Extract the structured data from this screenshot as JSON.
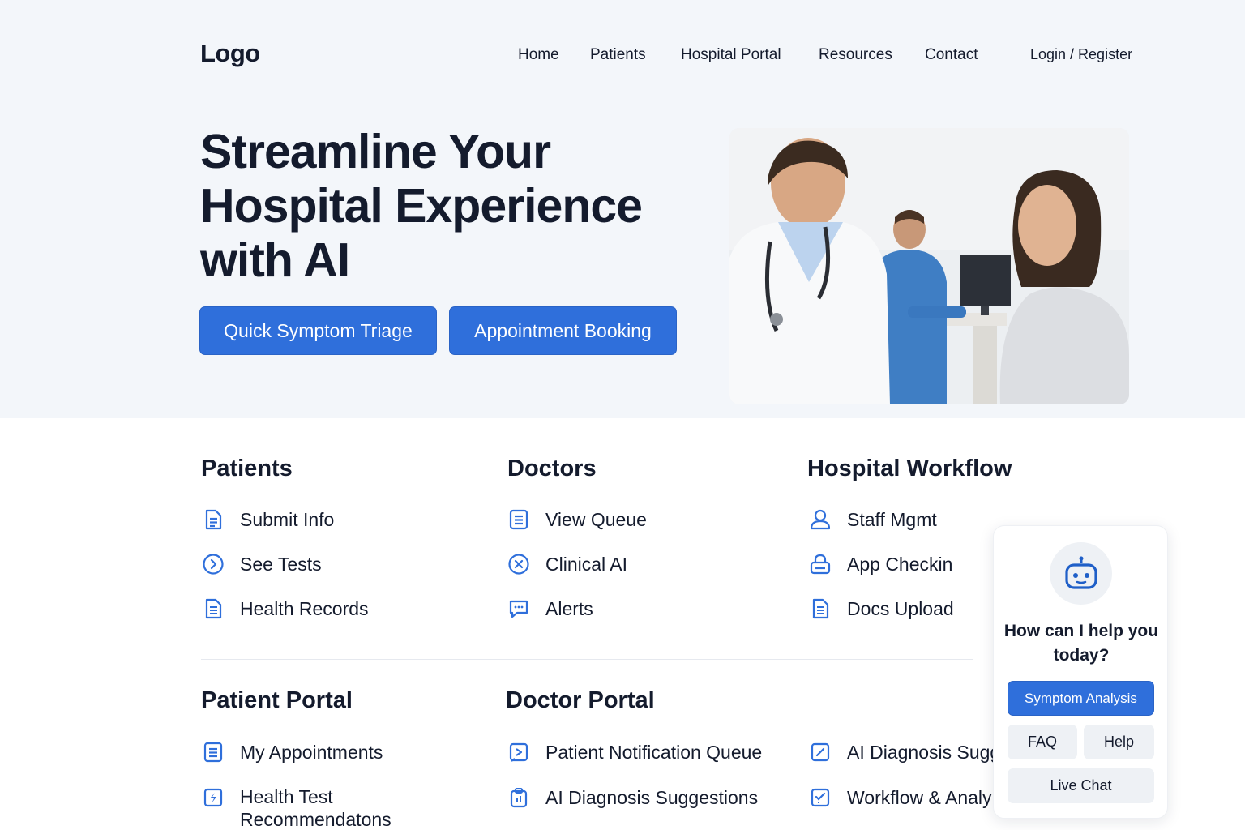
{
  "header": {
    "logo": "Logo",
    "nav": [
      "Home",
      "Patients",
      "Hospital Portal",
      "Resources",
      "Contact"
    ],
    "login": "Login / Register"
  },
  "hero": {
    "title": "Streamline Your Hospital Experience with AI",
    "buttons": {
      "triage": "Quick Symptom Triage",
      "booking": "Appointment Booking"
    },
    "image_alt": "doctor-consulting-patient-photo"
  },
  "sections": {
    "patients": {
      "title": "Patients",
      "items": [
        "Submit Info",
        "See Tests",
        "Health Records"
      ]
    },
    "doctors": {
      "title": "Doctors",
      "items": [
        "View Queue",
        "Clinical AI",
        "Alerts"
      ]
    },
    "workflow": {
      "title": "Hospital Workflow",
      "items": [
        "Staff Mgmt",
        "App Checkin",
        "Docs Upload"
      ]
    },
    "patient_portal": {
      "title": "Patient Portal",
      "items": [
        "My Appointments",
        "Health Test",
        "Recommendatons"
      ]
    },
    "doctor_portal": {
      "title": "Doctor Portal",
      "items": [
        "Patient Notification Queue",
        "AI Diagnosis Suggestions"
      ]
    },
    "extra": {
      "items": [
        "AI Diagnosis Sugg",
        "Workflow & Analy"
      ]
    }
  },
  "chat": {
    "question": "How can I help you today?",
    "buttons": {
      "symptom": "Symptom Analysis",
      "faq": "FAQ",
      "help": "Help",
      "live": "Live Chat"
    }
  },
  "colors": {
    "accent": "#2f6fdb",
    "text": "#141b2d",
    "hero_bg": "#f3f6fa"
  }
}
